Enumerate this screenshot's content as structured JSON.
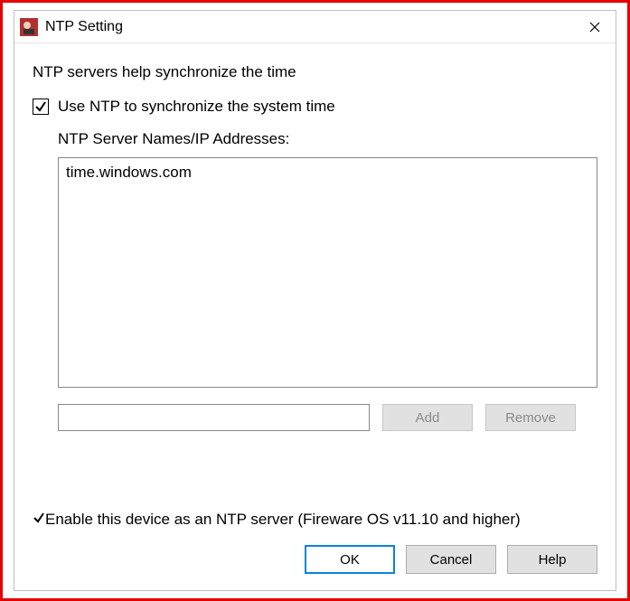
{
  "window": {
    "title": "NTP Setting"
  },
  "intro_text": "NTP servers help synchronize the time",
  "use_ntp": {
    "label": "Use NTP to synchronize the system time",
    "checked": true
  },
  "server_list": {
    "label": "NTP Server Names/IP Addresses:",
    "items": [
      "time.windows.com"
    ]
  },
  "add_input": {
    "value": "",
    "placeholder": ""
  },
  "buttons": {
    "add": "Add",
    "remove": "Remove",
    "ok": "OK",
    "cancel": "Cancel",
    "help": "Help"
  },
  "enable_server": {
    "label": "Enable this device as an NTP server (Fireware OS v11.10 and higher)",
    "checked": true
  }
}
